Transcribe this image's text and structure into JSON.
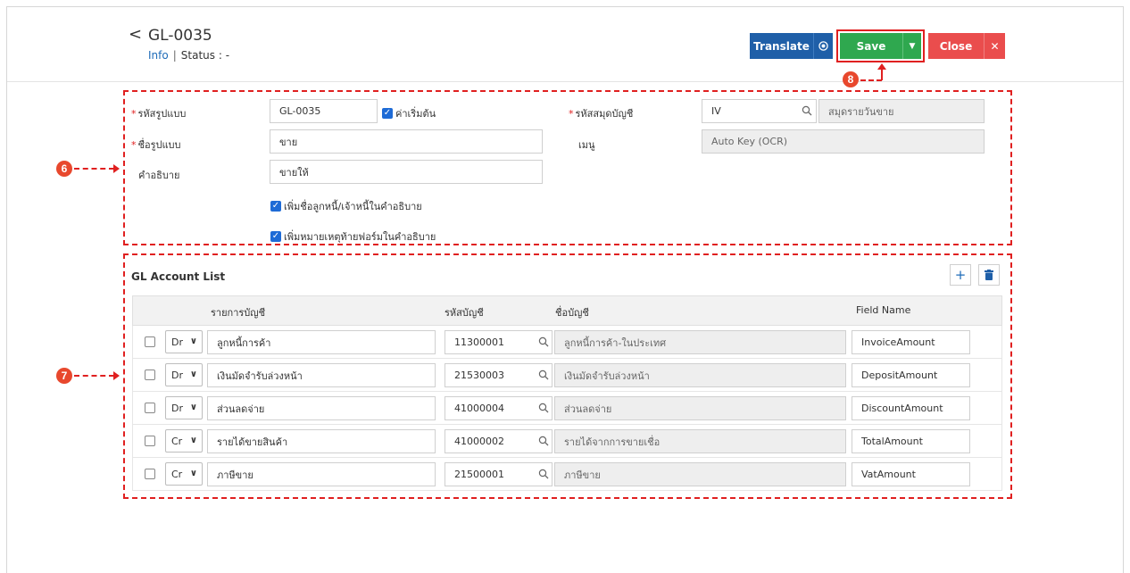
{
  "header": {
    "back_glyph": "<",
    "title": "GL-0035",
    "info": "Info",
    "separator": "|",
    "status_label": "Status",
    "status_colon": ":",
    "status_value": "-"
  },
  "actions": {
    "translate": "Translate",
    "save": "Save",
    "close": "Close"
  },
  "annotations": {
    "six": "6",
    "seven": "7",
    "eight": "8"
  },
  "form": {
    "code_label": "รหัสรูปแบบ",
    "code_value": "GL-0035",
    "default_label": "ค่าเริ่มต้น",
    "journal_label": "รหัสสมุดบัญชี",
    "journal_code": "IV",
    "journal_name": "สมุดรายวันขาย",
    "name_label": "ชื่อรูปแบบ",
    "name_value": "ขาย",
    "menu_label": "เมนู",
    "menu_value": "Auto Key (OCR)",
    "desc_label": "คำอธิบาย",
    "desc_value": "ขายให้",
    "opt_add_debtor": "เพิ่มชื่อลูกหนี้/เจ้าหนี้ในคำอธิบาย",
    "opt_add_note": "เพิ่มหมายเหตุท้ายฟอร์มในคำอธิบาย",
    "required_mark": "*"
  },
  "gl_list": {
    "title": "GL Account List",
    "columns": {
      "item": "รายการบัญชี",
      "account_code": "รหัสบัญชี",
      "account_name": "ชื่อบัญชี",
      "field_name": "Field Name"
    },
    "rows": [
      {
        "side": "Dr",
        "item": "ลูกหนี้การค้า",
        "code": "11300001",
        "name": "ลูกหนี้การค้า-ในประเทศ",
        "field": "InvoiceAmount"
      },
      {
        "side": "Dr",
        "item": "เงินมัดจำรับล่วงหน้า",
        "code": "21530003",
        "name": "เงินมัดจำรับล่วงหน้า",
        "field": "DepositAmount"
      },
      {
        "side": "Dr",
        "item": "ส่วนลดจ่าย",
        "code": "41000004",
        "name": "ส่วนลดจ่าย",
        "field": "DiscountAmount"
      },
      {
        "side": "Cr",
        "item": "รายได้ขายสินค้า",
        "code": "41000002",
        "name": "รายได้จากการขายเชื่อ",
        "field": "TotalAmount"
      },
      {
        "side": "Cr",
        "item": "ภาษีขาย",
        "code": "21500001",
        "name": "ภาษีขาย",
        "field": "VatAmount"
      }
    ]
  },
  "colors": {
    "save": "#2fa84f",
    "translate": "#1f5fa8",
    "close": "#ea4d4d",
    "annotation": "#e02020"
  }
}
